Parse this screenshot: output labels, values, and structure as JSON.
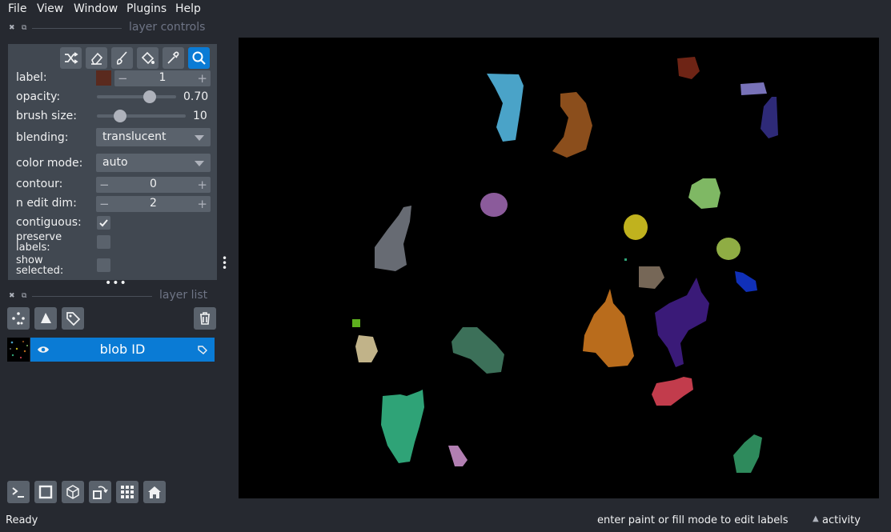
{
  "menu": [
    "File",
    "View",
    "Window",
    "Plugins",
    "Help"
  ],
  "layer_controls": {
    "title": "layer controls",
    "tools": [
      "shuffle-icon",
      "eraser-icon",
      "paint-brush-icon",
      "fill-bucket-icon",
      "color-picker-icon",
      "zoom-icon"
    ],
    "active_tool": "zoom-icon",
    "label": {
      "label": "label:",
      "color": "#5a2a1e",
      "value": "1",
      "minus": "−",
      "plus": "+"
    },
    "opacity": {
      "label": "opacity:",
      "value": "0.70",
      "fraction": 0.7
    },
    "brush_size": {
      "label": "brush size:",
      "value": "10",
      "fraction": 0.3
    },
    "blending": {
      "label": "blending:",
      "value": "translucent"
    },
    "color_mode": {
      "label": "color mode:",
      "value": "auto"
    },
    "contour": {
      "label": "contour:",
      "value": "0",
      "minus": "−",
      "plus": "+"
    },
    "n_edit_dim": {
      "label": "n edit dim:",
      "value": "2",
      "minus": "−",
      "plus": "+"
    },
    "contiguous": {
      "label": "contiguous:",
      "checked": true
    },
    "preserve_labels": {
      "label_line1": "preserve",
      "label_line2": "labels:",
      "checked": false
    },
    "show_selected": {
      "label_line1": "show",
      "label_line2": "selected:",
      "checked": false
    }
  },
  "layer_list": {
    "title": "layer list",
    "buttons": [
      "points-icon",
      "shapes-icon",
      "labels-icon"
    ],
    "delete": "trash-icon",
    "layers": [
      {
        "name": "blob ID",
        "visible": true,
        "type": "labels"
      }
    ]
  },
  "bottom_toolbar": [
    "console-icon",
    "ndisplay-2d-icon",
    "ndisplay-3d-icon",
    "roll-icon",
    "grid-icon",
    "home-icon"
  ],
  "status": {
    "left": "Ready",
    "hint": "enter paint or fill mode to edit labels",
    "activity": "activity"
  },
  "colors": {
    "background": "#262930",
    "panel": "#414851",
    "control": "#5a626c",
    "accent": "#0a7bd5",
    "canvas": "#000000"
  },
  "blobs": [
    {
      "color": "#4aa3c8"
    },
    {
      "color": "#8b4e1c"
    },
    {
      "color": "#6e2415"
    },
    {
      "color": "#7872b8"
    },
    {
      "color": "#2e2a78"
    },
    {
      "color": "#8b5b9b"
    },
    {
      "color": "#7fb864"
    },
    {
      "color": "#c0b21e"
    },
    {
      "color": "#676b73"
    },
    {
      "color": "#8fad44"
    },
    {
      "color": "#1030b8"
    },
    {
      "color": "#766757"
    },
    {
      "color": "#3a1a78"
    },
    {
      "color": "#b96c1c"
    },
    {
      "color": "#5eb01e"
    },
    {
      "color": "#c1b389"
    },
    {
      "color": "#3c7059"
    },
    {
      "color": "#c23c4c"
    },
    {
      "color": "#2fa377"
    },
    {
      "color": "#b27fb2"
    },
    {
      "color": "#2e8a5c"
    }
  ]
}
